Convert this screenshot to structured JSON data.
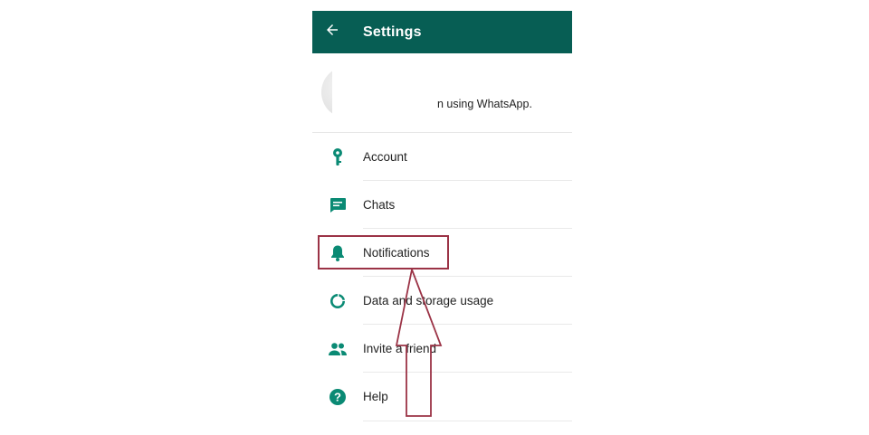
{
  "app": {
    "title": "Settings",
    "accent_color": "#075e54",
    "icon_color": "#0a8a74"
  },
  "appbar": {
    "back_icon": "arrow-left-icon",
    "title": "Settings"
  },
  "profile": {
    "status_text": "n using WhatsApp.",
    "avatar_icon": "avatar"
  },
  "menu": {
    "items": [
      {
        "label": "Account",
        "icon": "key-icon"
      },
      {
        "label": "Chats",
        "icon": "chat-icon"
      },
      {
        "label": "Notifications",
        "icon": "bell-icon"
      },
      {
        "label": "Data and storage usage",
        "icon": "data-usage-icon"
      },
      {
        "label": "Invite a friend",
        "icon": "people-icon"
      },
      {
        "label": "Help",
        "icon": "help-icon"
      }
    ]
  },
  "annotation": {
    "highlight_color": "#9b3346",
    "highlighted_item": "Notifications"
  }
}
